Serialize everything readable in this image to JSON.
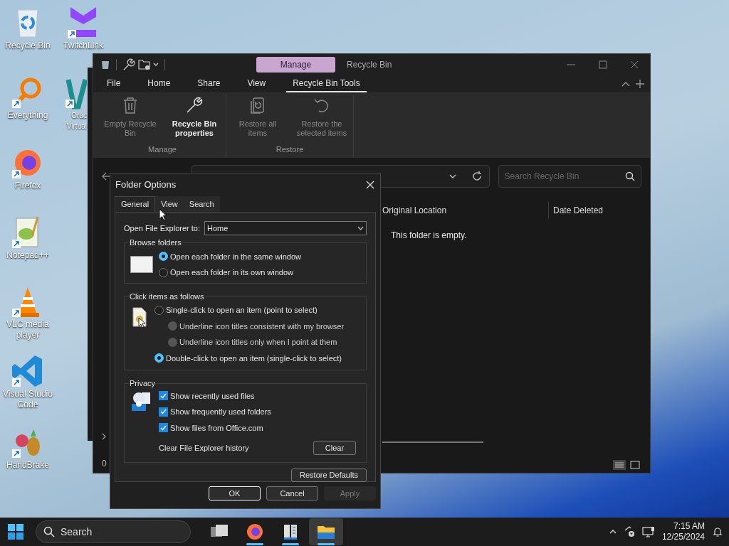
{
  "desktop_icons": [
    {
      "label": "Recycle Bin",
      "kind": "recycle"
    },
    {
      "label": "TwitchLink",
      "kind": "twitchlink"
    },
    {
      "label": "Everything",
      "kind": "everything"
    },
    {
      "label": "Orac Virtual",
      "kind": "virtualbox"
    },
    {
      "label": "Firefox",
      "kind": "firefox"
    },
    {
      "label": "Notepad++",
      "kind": "notepad"
    },
    {
      "label": "VLC media player",
      "kind": "vlc"
    },
    {
      "label": "Visual Studio Code",
      "kind": "vscode"
    },
    {
      "label": "HandBrake",
      "kind": "handbrake"
    }
  ],
  "explorer": {
    "context_tab": "Manage",
    "title": "Recycle Bin",
    "ribbon_tabs": [
      {
        "label": "File",
        "selected": false
      },
      {
        "label": "Home",
        "selected": false
      },
      {
        "label": "Share",
        "selected": false
      },
      {
        "label": "View",
        "selected": false
      },
      {
        "label": "Recycle Bin Tools",
        "selected": true
      }
    ],
    "ribbon_groups": [
      {
        "label": "Manage",
        "buttons": [
          {
            "label": "Empty Recycle Bin",
            "kind": "trash",
            "disabled": true
          },
          {
            "label": "Recycle Bin properties",
            "kind": "wrench",
            "disabled": false
          }
        ]
      },
      {
        "label": "Restore",
        "buttons": [
          {
            "label": "Restore all items",
            "kind": "restore-all",
            "disabled": true
          },
          {
            "label": "Restore the selected items",
            "kind": "undo",
            "disabled": true
          }
        ]
      }
    ],
    "search": {
      "placeholder": "Search Recycle Bin"
    },
    "columns": [
      "Original Location",
      "Date Deleted"
    ],
    "empty_message": "This folder is empty.",
    "status": "0"
  },
  "dialog": {
    "title": "Folder Options",
    "tabs": [
      {
        "label": "General",
        "selected": true
      },
      {
        "label": "View",
        "selected": false
      },
      {
        "label": "Search",
        "selected": false
      }
    ],
    "open_to": {
      "label": "Open File Explorer to:",
      "value": "Home"
    },
    "browse": {
      "title": "Browse folders",
      "options": [
        {
          "label": "Open each folder in the same window",
          "selected": true,
          "disabled": false
        },
        {
          "label": "Open each folder in its own window",
          "selected": false,
          "disabled": false
        }
      ]
    },
    "click": {
      "title": "Click items as follows",
      "options": [
        {
          "label": "Single-click to open an item (point to select)",
          "selected": false,
          "disabled": false,
          "children": [
            {
              "label": "Underline icon titles consistent with my browser",
              "selected": false,
              "disabled": true
            },
            {
              "label": "Underline icon titles only when I point at them",
              "selected": false,
              "disabled": true
            }
          ]
        },
        {
          "label": "Double-click to open an item (single-click to select)",
          "selected": true,
          "disabled": false
        }
      ]
    },
    "privacy": {
      "title": "Privacy",
      "checks": [
        {
          "label": "Show recently used files",
          "checked": true
        },
        {
          "label": "Show frequently used folders",
          "checked": true
        },
        {
          "label": "Show files from Office.com",
          "checked": true
        }
      ],
      "clear_label": "Clear File Explorer history",
      "clear_button": "Clear"
    },
    "restore_defaults": "Restore Defaults",
    "buttons": [
      {
        "label": "OK",
        "default": true,
        "disabled": false
      },
      {
        "label": "Cancel",
        "default": false,
        "disabled": false
      },
      {
        "label": "Apply",
        "default": false,
        "disabled": true
      }
    ]
  },
  "taskbar": {
    "search": "Search",
    "apps": [
      {
        "kind": "taskview",
        "running": false,
        "active": false
      },
      {
        "kind": "firefox",
        "running": true,
        "active": false
      },
      {
        "kind": "reader",
        "running": true,
        "active": false
      },
      {
        "kind": "explorer",
        "running": true,
        "active": true
      }
    ],
    "time": "7:15 AM",
    "date": "12/25/2024"
  }
}
